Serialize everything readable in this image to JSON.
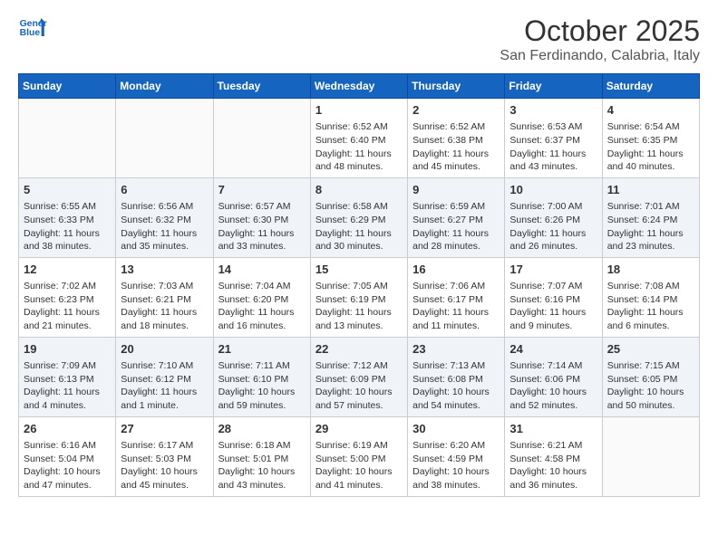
{
  "header": {
    "logo_line1": "General",
    "logo_line2": "Blue",
    "title": "October 2025",
    "subtitle": "San Ferdinando, Calabria, Italy"
  },
  "weekdays": [
    "Sunday",
    "Monday",
    "Tuesday",
    "Wednesday",
    "Thursday",
    "Friday",
    "Saturday"
  ],
  "weeks": [
    [
      {
        "day": "",
        "info": ""
      },
      {
        "day": "",
        "info": ""
      },
      {
        "day": "",
        "info": ""
      },
      {
        "day": "1",
        "info": "Sunrise: 6:52 AM\nSunset: 6:40 PM\nDaylight: 11 hours\nand 48 minutes."
      },
      {
        "day": "2",
        "info": "Sunrise: 6:52 AM\nSunset: 6:38 PM\nDaylight: 11 hours\nand 45 minutes."
      },
      {
        "day": "3",
        "info": "Sunrise: 6:53 AM\nSunset: 6:37 PM\nDaylight: 11 hours\nand 43 minutes."
      },
      {
        "day": "4",
        "info": "Sunrise: 6:54 AM\nSunset: 6:35 PM\nDaylight: 11 hours\nand 40 minutes."
      }
    ],
    [
      {
        "day": "5",
        "info": "Sunrise: 6:55 AM\nSunset: 6:33 PM\nDaylight: 11 hours\nand 38 minutes."
      },
      {
        "day": "6",
        "info": "Sunrise: 6:56 AM\nSunset: 6:32 PM\nDaylight: 11 hours\nand 35 minutes."
      },
      {
        "day": "7",
        "info": "Sunrise: 6:57 AM\nSunset: 6:30 PM\nDaylight: 11 hours\nand 33 minutes."
      },
      {
        "day": "8",
        "info": "Sunrise: 6:58 AM\nSunset: 6:29 PM\nDaylight: 11 hours\nand 30 minutes."
      },
      {
        "day": "9",
        "info": "Sunrise: 6:59 AM\nSunset: 6:27 PM\nDaylight: 11 hours\nand 28 minutes."
      },
      {
        "day": "10",
        "info": "Sunrise: 7:00 AM\nSunset: 6:26 PM\nDaylight: 11 hours\nand 26 minutes."
      },
      {
        "day": "11",
        "info": "Sunrise: 7:01 AM\nSunset: 6:24 PM\nDaylight: 11 hours\nand 23 minutes."
      }
    ],
    [
      {
        "day": "12",
        "info": "Sunrise: 7:02 AM\nSunset: 6:23 PM\nDaylight: 11 hours\nand 21 minutes."
      },
      {
        "day": "13",
        "info": "Sunrise: 7:03 AM\nSunset: 6:21 PM\nDaylight: 11 hours\nand 18 minutes."
      },
      {
        "day": "14",
        "info": "Sunrise: 7:04 AM\nSunset: 6:20 PM\nDaylight: 11 hours\nand 16 minutes."
      },
      {
        "day": "15",
        "info": "Sunrise: 7:05 AM\nSunset: 6:19 PM\nDaylight: 11 hours\nand 13 minutes."
      },
      {
        "day": "16",
        "info": "Sunrise: 7:06 AM\nSunset: 6:17 PM\nDaylight: 11 hours\nand 11 minutes."
      },
      {
        "day": "17",
        "info": "Sunrise: 7:07 AM\nSunset: 6:16 PM\nDaylight: 11 hours\nand 9 minutes."
      },
      {
        "day": "18",
        "info": "Sunrise: 7:08 AM\nSunset: 6:14 PM\nDaylight: 11 hours\nand 6 minutes."
      }
    ],
    [
      {
        "day": "19",
        "info": "Sunrise: 7:09 AM\nSunset: 6:13 PM\nDaylight: 11 hours\nand 4 minutes."
      },
      {
        "day": "20",
        "info": "Sunrise: 7:10 AM\nSunset: 6:12 PM\nDaylight: 11 hours\nand 1 minute."
      },
      {
        "day": "21",
        "info": "Sunrise: 7:11 AM\nSunset: 6:10 PM\nDaylight: 10 hours\nand 59 minutes."
      },
      {
        "day": "22",
        "info": "Sunrise: 7:12 AM\nSunset: 6:09 PM\nDaylight: 10 hours\nand 57 minutes."
      },
      {
        "day": "23",
        "info": "Sunrise: 7:13 AM\nSunset: 6:08 PM\nDaylight: 10 hours\nand 54 minutes."
      },
      {
        "day": "24",
        "info": "Sunrise: 7:14 AM\nSunset: 6:06 PM\nDaylight: 10 hours\nand 52 minutes."
      },
      {
        "day": "25",
        "info": "Sunrise: 7:15 AM\nSunset: 6:05 PM\nDaylight: 10 hours\nand 50 minutes."
      }
    ],
    [
      {
        "day": "26",
        "info": "Sunrise: 6:16 AM\nSunset: 5:04 PM\nDaylight: 10 hours\nand 47 minutes."
      },
      {
        "day": "27",
        "info": "Sunrise: 6:17 AM\nSunset: 5:03 PM\nDaylight: 10 hours\nand 45 minutes."
      },
      {
        "day": "28",
        "info": "Sunrise: 6:18 AM\nSunset: 5:01 PM\nDaylight: 10 hours\nand 43 minutes."
      },
      {
        "day": "29",
        "info": "Sunrise: 6:19 AM\nSunset: 5:00 PM\nDaylight: 10 hours\nand 41 minutes."
      },
      {
        "day": "30",
        "info": "Sunrise: 6:20 AM\nSunset: 4:59 PM\nDaylight: 10 hours\nand 38 minutes."
      },
      {
        "day": "31",
        "info": "Sunrise: 6:21 AM\nSunset: 4:58 PM\nDaylight: 10 hours\nand 36 minutes."
      },
      {
        "day": "",
        "info": ""
      }
    ]
  ]
}
